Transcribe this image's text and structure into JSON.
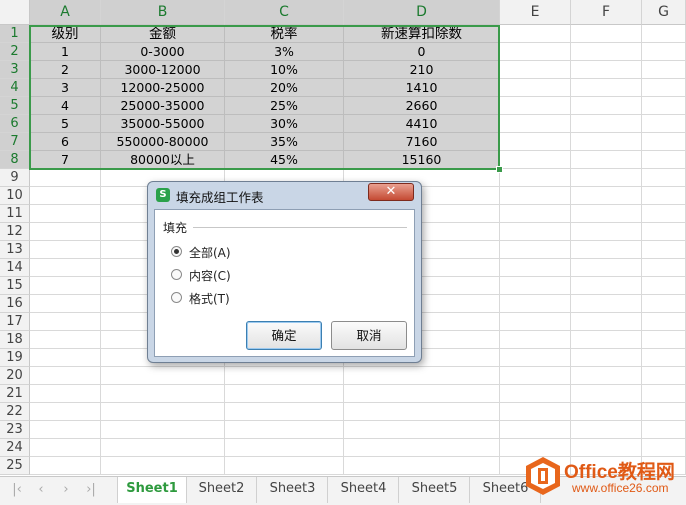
{
  "columns": [
    "A",
    "B",
    "C",
    "D",
    "E",
    "F",
    "G"
  ],
  "rows": [
    "1",
    "2",
    "3",
    "4",
    "5",
    "6",
    "7",
    "8",
    "9",
    "10",
    "11",
    "12",
    "13",
    "14",
    "15",
    "16",
    "17",
    "18",
    "19",
    "20",
    "21",
    "22",
    "23",
    "24",
    "25"
  ],
  "table": {
    "headers": [
      "级别",
      "金额",
      "税率",
      "新速算扣除数"
    ],
    "data": [
      [
        "1",
        "0-3000",
        "3%",
        "0"
      ],
      [
        "2",
        "3000-12000",
        "10%",
        "210"
      ],
      [
        "3",
        "12000-25000",
        "20%",
        "1410"
      ],
      [
        "4",
        "25000-35000",
        "25%",
        "2660"
      ],
      [
        "5",
        "35000-55000",
        "30%",
        "4410"
      ],
      [
        "6",
        "550000-80000",
        "35%",
        "7160"
      ],
      [
        "7",
        "80000以上",
        "45%",
        "15160"
      ]
    ]
  },
  "dialog": {
    "app_icon": "S",
    "title": "填充成组工作表",
    "close_icon": "close-icon",
    "group_label": "填充",
    "options": [
      {
        "label": "全部(A)",
        "checked": true
      },
      {
        "label": "内容(C)",
        "checked": false
      },
      {
        "label": "格式(T)",
        "checked": false
      }
    ],
    "ok_label": "确定",
    "cancel_label": "取消"
  },
  "sheet_tabs": [
    "Sheet1",
    "Sheet2",
    "Sheet3",
    "Sheet4",
    "Sheet5",
    "Sheet6"
  ],
  "active_tab": "Sheet1",
  "nav_icons": [
    "first-sheet-icon",
    "prev-sheet-icon",
    "next-sheet-icon",
    "last-sheet-icon"
  ],
  "watermark": {
    "title": "Office教程网",
    "url": "www.office26.com"
  },
  "colors": {
    "selection_border": "#3a9a4a",
    "active_tab": "#2e9a3e",
    "watermark": "#e05a16"
  }
}
